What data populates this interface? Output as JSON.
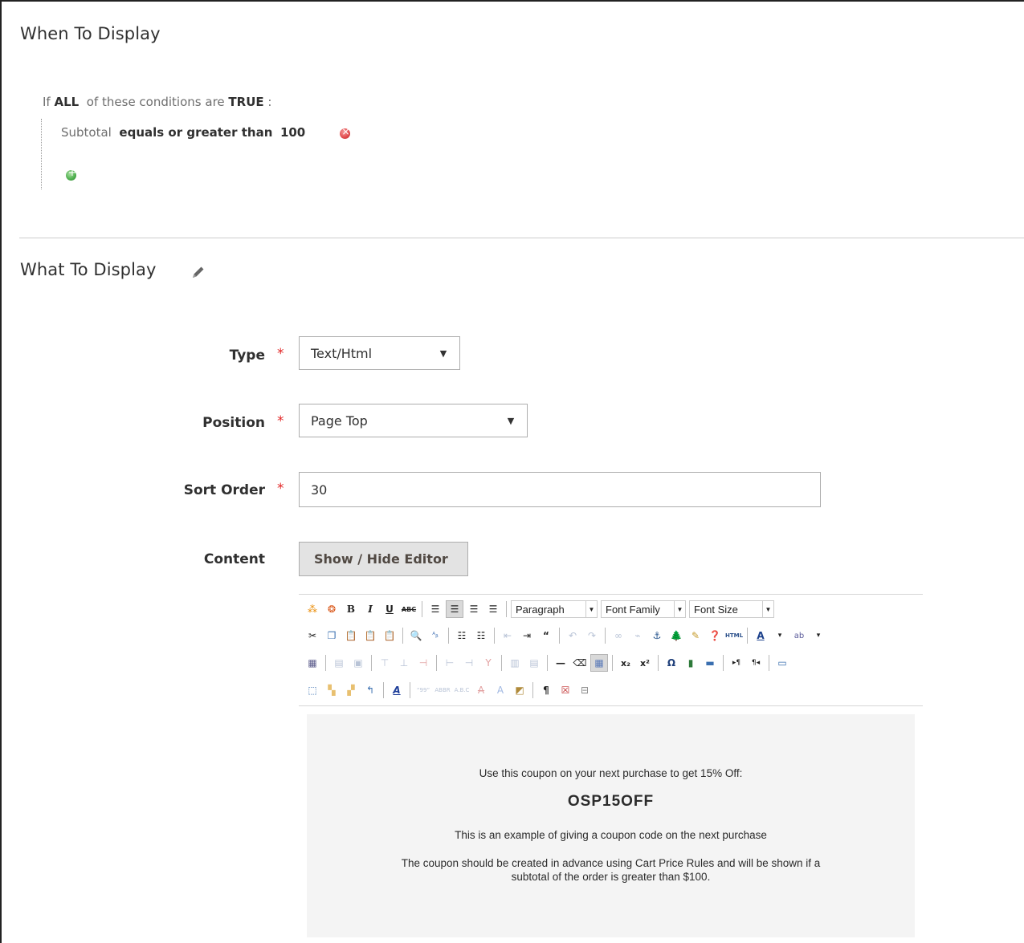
{
  "when_section": {
    "title": "When To Display",
    "condition_prefix": "If",
    "aggregator": "ALL",
    "condition_mid": "of these conditions are",
    "value": "TRUE",
    "suffix": ":",
    "rule": {
      "attribute": "Subtotal",
      "operator": "equals or greater than",
      "value": "100"
    }
  },
  "what_section": {
    "title": "What To Display",
    "fields": {
      "type": {
        "label": "Type",
        "required_mark": "*",
        "value": "Text/Html"
      },
      "position": {
        "label": "Position",
        "required_mark": "*",
        "value": "Page Top"
      },
      "sort_order": {
        "label": "Sort Order",
        "required_mark": "*",
        "value": "30"
      },
      "content": {
        "label": "Content",
        "toggle_button": "Show / Hide Editor"
      }
    },
    "editor": {
      "toolbar": {
        "format_select": "Paragraph",
        "font_family_select": "Font Family",
        "font_size_select": "Font Size"
      },
      "body": {
        "line1": "Use this coupon on your next purchase to get 15% Off:",
        "coupon_code": "OSP15OFF",
        "line2": "This is an example of giving a coupon code on the next purchase",
        "line3a": "The coupon should be created in advance using Cart Price Rules and will be shown if a",
        "line3b": "subtotal of the order is greater than $100."
      }
    }
  },
  "colors": {
    "required": "#e22626",
    "editor_bg": "#f4f4f4",
    "button_bg": "#e3e3e3"
  }
}
